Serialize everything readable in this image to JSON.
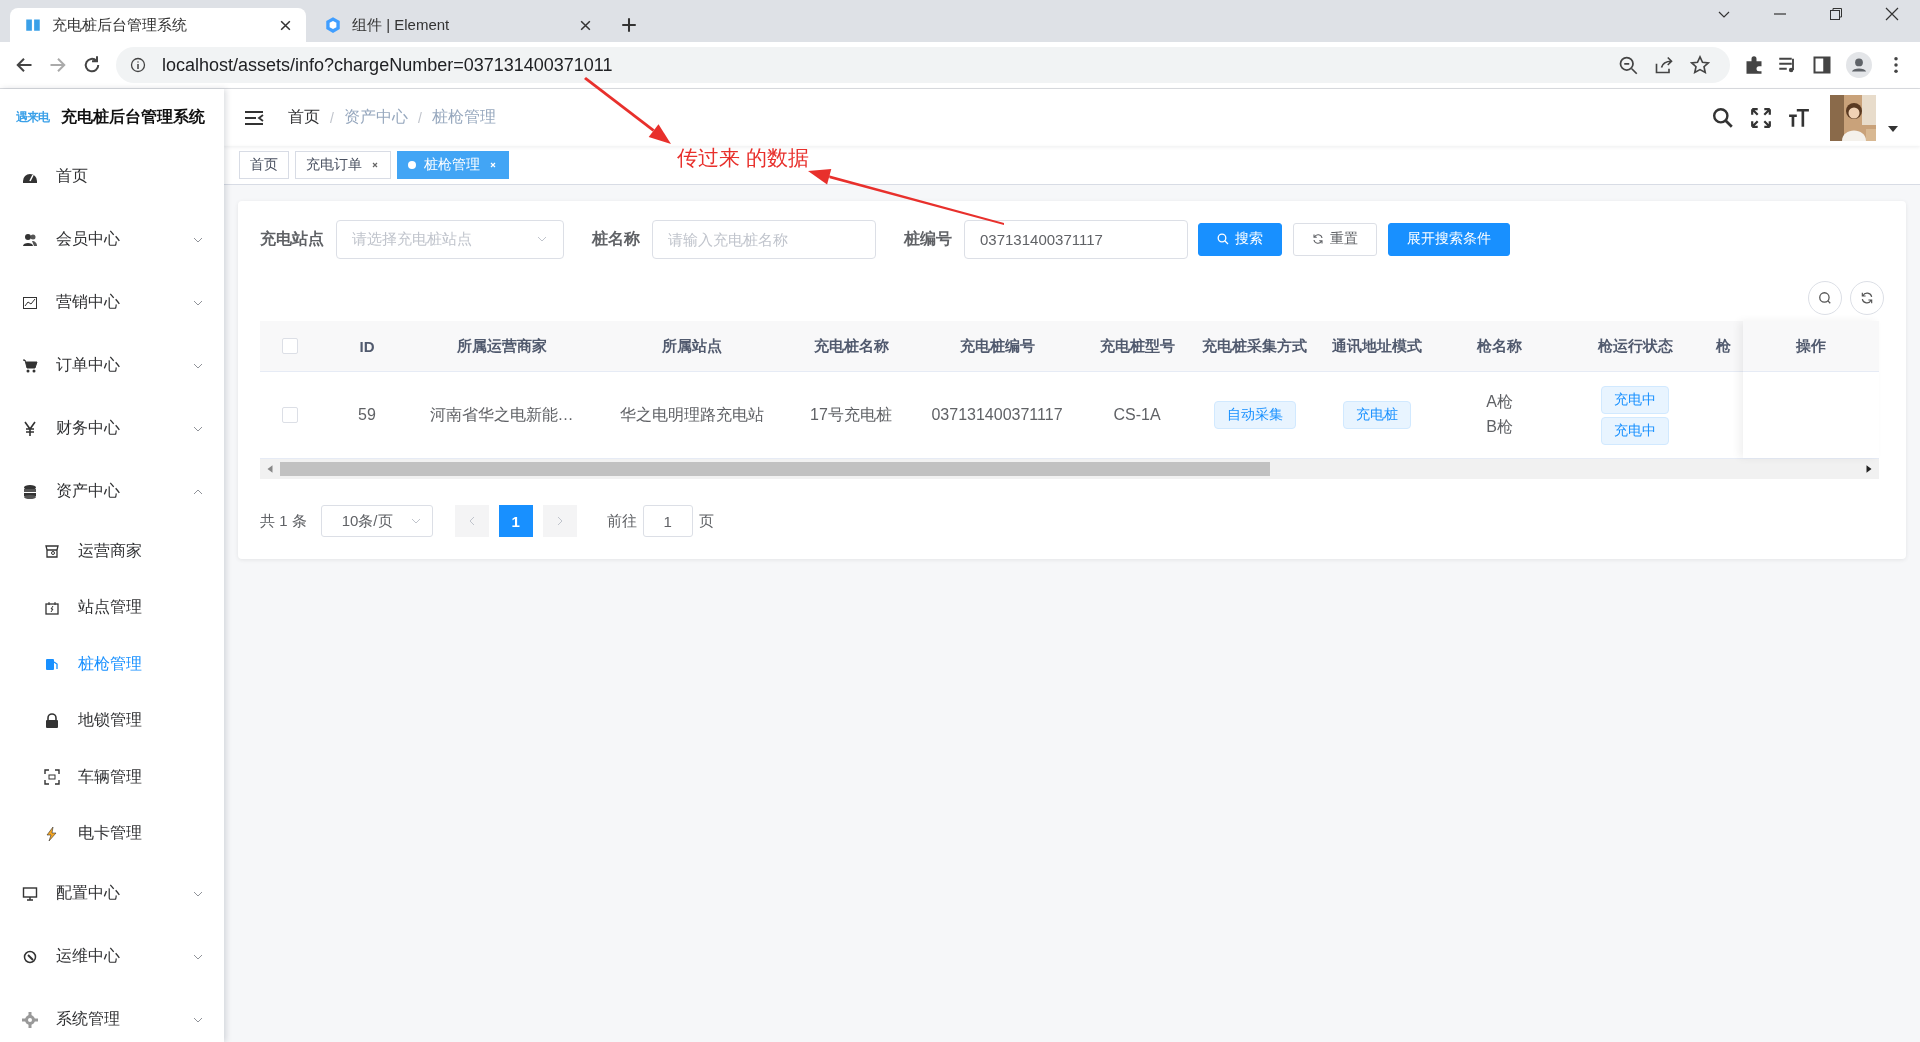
{
  "browser": {
    "tabs": [
      {
        "title": "充电桩后台管理系统",
        "selected": true
      },
      {
        "title": "组件 | Element",
        "selected": false
      }
    ],
    "url": "localhost/assets/info?chargeNumber=037131400371011"
  },
  "app": {
    "logo_text": "遇来电",
    "title": "充电桩后台管理系统"
  },
  "sidebar": {
    "items": [
      {
        "label": "首页",
        "selected": false
      },
      {
        "label": "会员中心",
        "selected": false,
        "expanded": false
      },
      {
        "label": "营销中心",
        "selected": false,
        "expanded": false
      },
      {
        "label": "订单中心",
        "selected": false,
        "expanded": false
      },
      {
        "label": "财务中心",
        "selected": false,
        "expanded": false
      },
      {
        "label": "资产中心",
        "selected": false,
        "expanded": true,
        "children": [
          {
            "label": "运营商家",
            "selected": false
          },
          {
            "label": "站点管理",
            "selected": false
          },
          {
            "label": "桩枪管理",
            "selected": true
          },
          {
            "label": "地锁管理",
            "selected": false
          },
          {
            "label": "车辆管理",
            "selected": false
          },
          {
            "label": "电卡管理",
            "selected": false
          }
        ]
      },
      {
        "label": "配置中心",
        "selected": false,
        "expanded": false
      },
      {
        "label": "运维中心",
        "selected": false,
        "expanded": false
      },
      {
        "label": "系统管理",
        "selected": false,
        "expanded": false
      }
    ]
  },
  "breadcrumb": {
    "separator": "/",
    "items": [
      "首页",
      "资产中心",
      "桩枪管理"
    ]
  },
  "tags": [
    {
      "label": "首页",
      "selected": false,
      "closable": false
    },
    {
      "label": "充电订单",
      "selected": false,
      "closable": true
    },
    {
      "label": "桩枪管理",
      "selected": true,
      "closable": true
    }
  ],
  "annotation": {
    "text": "传过来 的数据"
  },
  "filters": [
    {
      "label": "充电站点",
      "kind": "select",
      "placeholder": "请选择充电桩站点"
    },
    {
      "label": "桩名称",
      "kind": "input",
      "placeholder": "请输入充电桩名称"
    },
    {
      "label": "桩编号",
      "kind": "input",
      "value": "037131400371117"
    }
  ],
  "buttons": [
    {
      "label": "搜索",
      "kind": "primary"
    },
    {
      "label": "重置",
      "kind": "default"
    },
    {
      "label": "展开搜索条件",
      "kind": "primary"
    }
  ],
  "table": {
    "all_checked": false,
    "columns": [
      "ID",
      "所属运营商家",
      "所属站点",
      "充电桩名称",
      "充电桩编号",
      "充电桩型号",
      "充电桩采集方式",
      "通讯地址模式",
      "枪名称",
      "枪运行状态",
      "枪"
    ],
    "fixed_column": "操作",
    "rows": [
      {
        "checked": false,
        "cells": [
          {
            "kind": "text",
            "text": "59"
          },
          {
            "kind": "text",
            "text": "河南省华之电新能…"
          },
          {
            "kind": "text",
            "text": "华之电明理路充电站"
          },
          {
            "kind": "text",
            "text": "17号充电桩"
          },
          {
            "kind": "text",
            "text": "037131400371117"
          },
          {
            "kind": "text",
            "text": "CS-1A"
          },
          {
            "kind": "tags",
            "items": [
              "自动采集"
            ]
          },
          {
            "kind": "tags",
            "items": [
              "充电桩"
            ]
          },
          {
            "kind": "lines",
            "items": [
              "A枪",
              "B枪"
            ]
          },
          {
            "kind": "tags",
            "items": [
              "充电中",
              "充电中"
            ]
          }
        ]
      }
    ]
  },
  "pagination": {
    "total": "共 1 条",
    "page_size": "10条/页",
    "prev_disabled": true,
    "next_disabled": true,
    "pages": [
      {
        "label": "1",
        "selected": true
      }
    ],
    "goto_label": "前往",
    "goto_value": "1",
    "goto_suffix": "页"
  }
}
